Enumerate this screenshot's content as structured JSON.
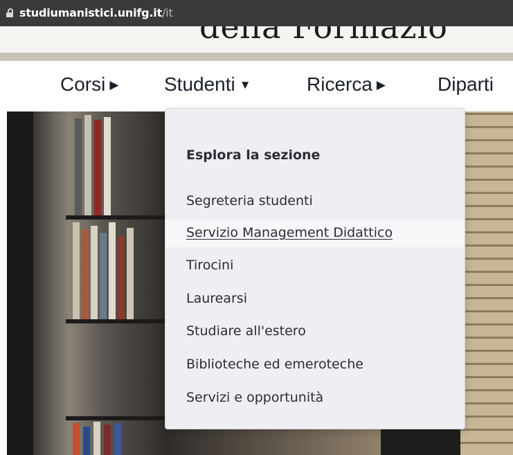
{
  "browser": {
    "url_host": "studiumanistici.unifg.it",
    "url_path": "/it"
  },
  "nav": {
    "items": [
      {
        "label": "Corsi"
      },
      {
        "label": "Studenti"
      },
      {
        "label": "Ricerca"
      },
      {
        "label": "Diparti"
      }
    ]
  },
  "dropdown": {
    "heading": "Esplora la sezione",
    "items": [
      {
        "label": "Segreteria studenti"
      },
      {
        "label": "Servizio Management Didattico",
        "hovered": true
      },
      {
        "label": "Tirocini"
      },
      {
        "label": "Laurearsi"
      },
      {
        "label": "Studiare all'estero"
      },
      {
        "label": "Biblioteche ed emeroteche"
      },
      {
        "label": "Servizi e opportunità"
      }
    ]
  },
  "icons": {
    "lock": "lock-icon",
    "caret_right": "caret-right-icon",
    "caret_down": "caret-down-icon"
  }
}
